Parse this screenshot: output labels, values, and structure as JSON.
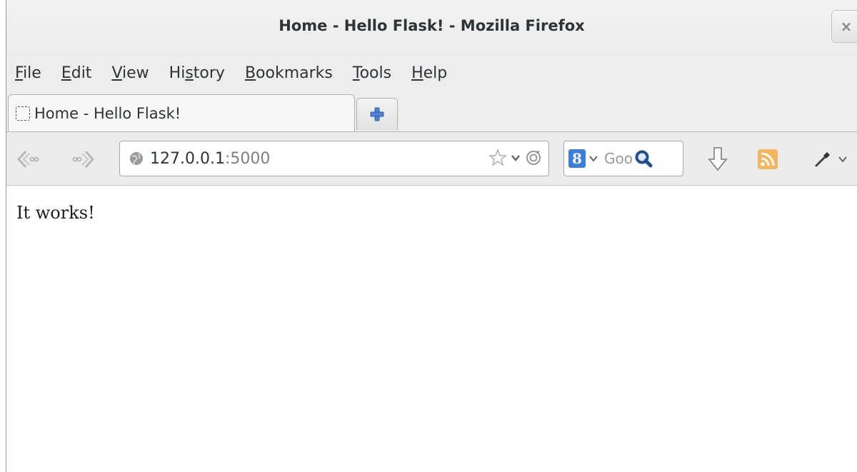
{
  "window": {
    "title": "Home - Hello Flask! - Mozilla Firefox",
    "close_glyph": "×"
  },
  "menu": {
    "items": [
      {
        "accel": "F",
        "rest": "ile"
      },
      {
        "accel": "E",
        "rest": "dit"
      },
      {
        "accel": "V",
        "rest": "iew"
      },
      {
        "pre": "Hi",
        "accel": "s",
        "rest": "tory"
      },
      {
        "accel": "B",
        "rest": "ookmarks"
      },
      {
        "accel": "T",
        "rest": "ools"
      },
      {
        "accel": "H",
        "rest": "elp"
      }
    ]
  },
  "tabs": [
    {
      "label": "Home - Hello Flask!",
      "active": true
    }
  ],
  "url": {
    "host": "127.0.0.1",
    "port": ":5000"
  },
  "search": {
    "engine_badge": "8",
    "placeholder": "Goo"
  },
  "page": {
    "text": "It works!"
  },
  "colors": {
    "search_engine": "#3a7ede",
    "feed": "#f0a030"
  }
}
